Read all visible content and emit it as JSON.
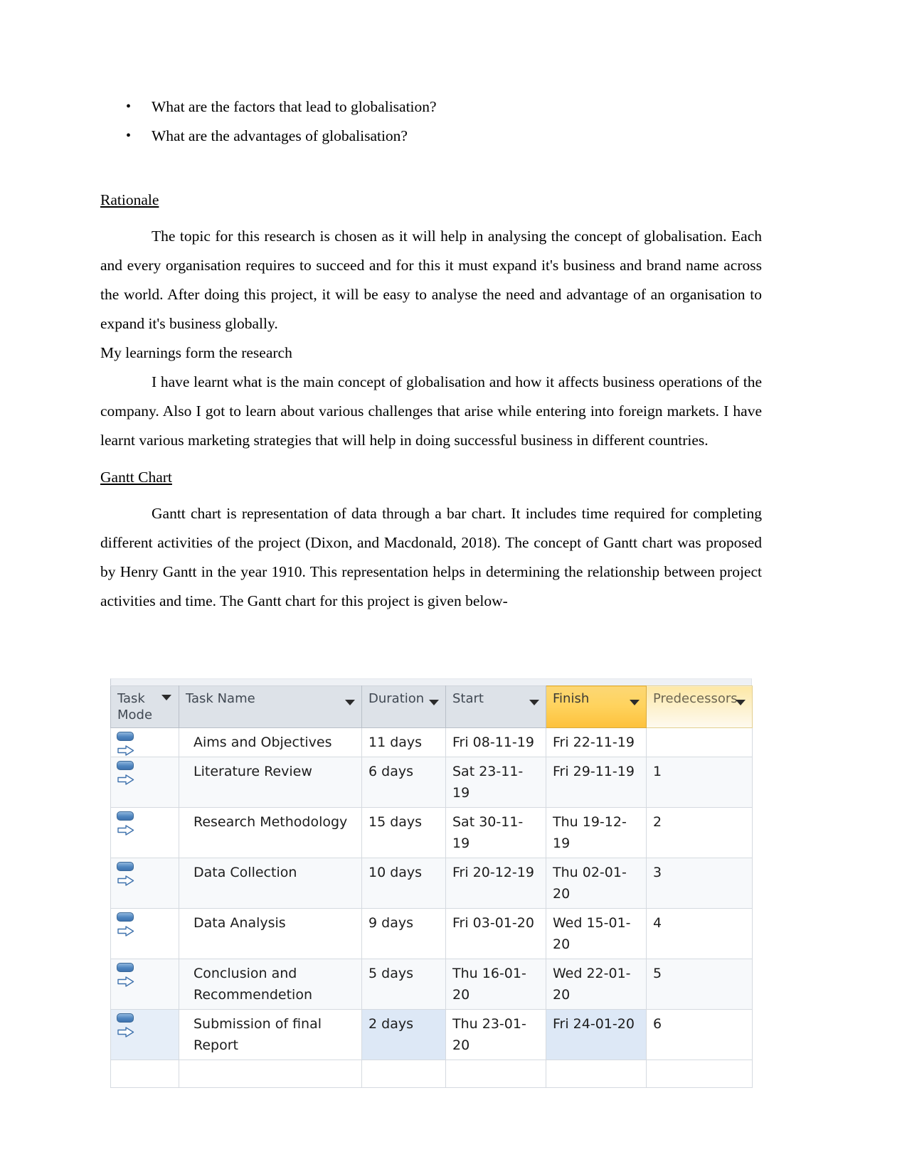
{
  "document": {
    "bullets": [
      "What are the factors that lead to globalisation?",
      "What are the advantages of globalisation?"
    ],
    "sections": [
      {
        "heading": "Rationale ",
        "paragraphs": [
          "The topic for this research is chosen as it will help in analysing the concept of globalisation. Each and every organisation requires to succeed and for this it must expand it's business and brand name across the world. After doing this project, it will be easy to analyse the need and advantage of an organisation to expand it's business globally."
        ]
      }
    ],
    "subheading_plain": "My learnings form the research",
    "learnings_paragraph": "I have learnt what is the main concept of globalisation and how it affects business operations of the company. Also I got to learn about various challenges that arise while entering into foreign markets.  I have learnt various marketing strategies that will help in doing successful business in different countries.",
    "gantt_heading": "Gantt Chart ",
    "gantt_paragraph": "Gantt chart is representation of data through a bar chart. It includes time required for completing different activities of the project (Dixon, and Macdonald, 2018). The concept of Gantt chart was proposed by Henry Gantt in the year 1910. This representation helps in determining the relationship between project activities and time.  The Gantt chart for this project is given below-",
    "bullet_glyph": "•"
  },
  "gantt_table": {
    "columns": [
      {
        "key": "task_mode",
        "label": "Task Mode",
        "has_filter": true,
        "highlight": "none"
      },
      {
        "key": "task_name",
        "label": "Task Name",
        "has_filter": true,
        "highlight": "none"
      },
      {
        "key": "duration",
        "label": "Duration",
        "has_filter": true,
        "highlight": "none"
      },
      {
        "key": "start",
        "label": "Start",
        "has_filter": true,
        "highlight": "none"
      },
      {
        "key": "finish",
        "label": "Finish",
        "has_filter": true,
        "highlight": "gold"
      },
      {
        "key": "predecessors",
        "label": "Predecessors",
        "has_filter": true,
        "highlight": "light-gold"
      }
    ],
    "header_line1": "Task",
    "header_line2": "Mode",
    "mode_icon_name": "auto-scheduled-icon",
    "rows": [
      {
        "mode": "auto-scheduled-icon",
        "name": "Aims and Objectives",
        "duration": "11 days",
        "start": "Fri 08-11-19",
        "finish": "Fri 22-11-19",
        "pred": "",
        "selected": false
      },
      {
        "mode": "auto-scheduled-icon",
        "name": "Literature Review",
        "duration": "6 days",
        "start": "Sat 23-11-19",
        "finish": "Fri 29-11-19",
        "pred": "1",
        "selected": false
      },
      {
        "mode": "auto-scheduled-icon",
        "name": "Research Methodology",
        "duration": "15 days",
        "start": "Sat 30-11-19",
        "finish": "Thu 19-12-19",
        "pred": "2",
        "selected": false
      },
      {
        "mode": "auto-scheduled-icon",
        "name": "Data Collection",
        "duration": "10 days",
        "start": "Fri 20-12-19",
        "finish": "Thu 02-01-20",
        "pred": "3",
        "selected": false
      },
      {
        "mode": "auto-scheduled-icon",
        "name": "Data Analysis",
        "duration": "9 days",
        "start": "Fri 03-01-20",
        "finish": "Wed 15-01-20",
        "pred": "4",
        "selected": false
      },
      {
        "mode": "auto-scheduled-icon",
        "name": "Conclusion and Recommendetion",
        "duration": "5 days",
        "start": "Thu 16-01-20",
        "finish": "Wed 22-01-20",
        "pred": "5",
        "selected": false
      },
      {
        "mode": "auto-scheduled-icon",
        "name": "Submission of final Report",
        "duration": "2 days",
        "start": "Thu 23-01-20",
        "finish": "Fri 24-01-20",
        "pred": "6",
        "selected": true
      }
    ],
    "colors": {
      "header_bg": "#dde2e8",
      "header_gold": "#ffd35e",
      "header_light_gold": "#fdf3d4",
      "grid": "#d5dae0",
      "selection": "#dde8f6",
      "icon_blue": "#4f86c0"
    }
  }
}
